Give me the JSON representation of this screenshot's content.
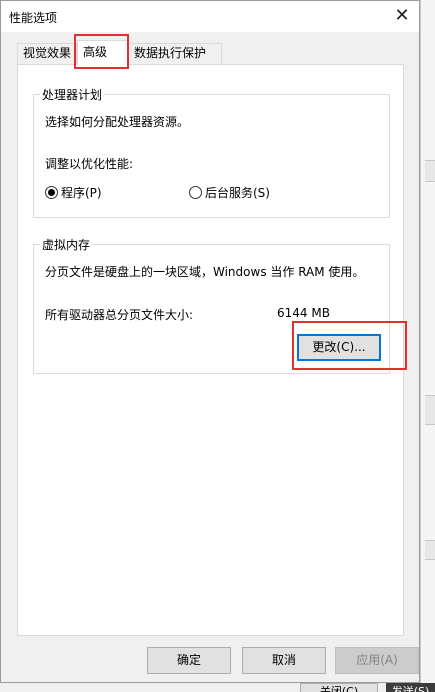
{
  "window": {
    "title": "性能选项"
  },
  "tabs": [
    {
      "label": "视觉效果"
    },
    {
      "label": "高级"
    },
    {
      "label": "数据执行保护"
    }
  ],
  "processor_group": {
    "title": "处理器计划",
    "description": "选择如何分配处理器资源。",
    "adjust_label": "调整以优化性能:",
    "options": [
      {
        "label": "程序(P)",
        "selected": true
      },
      {
        "label": "后台服务(S)",
        "selected": false
      }
    ]
  },
  "virtual_memory_group": {
    "title": "虚拟内存",
    "description": "分页文件是硬盘上的一块区域，Windows 当作 RAM 使用。",
    "total_label": "所有驱动器总分页文件大小:",
    "total_value": "6144 MB",
    "change_button": "更改(C)..."
  },
  "footer": {
    "ok": "确定",
    "cancel": "取消",
    "apply": "应用(A)"
  },
  "background": {
    "close_button": "关闭(C)",
    "send_button": "发送(S)"
  },
  "colors": {
    "highlight_red": "#e03030",
    "focus_blue": "#0078d7"
  }
}
